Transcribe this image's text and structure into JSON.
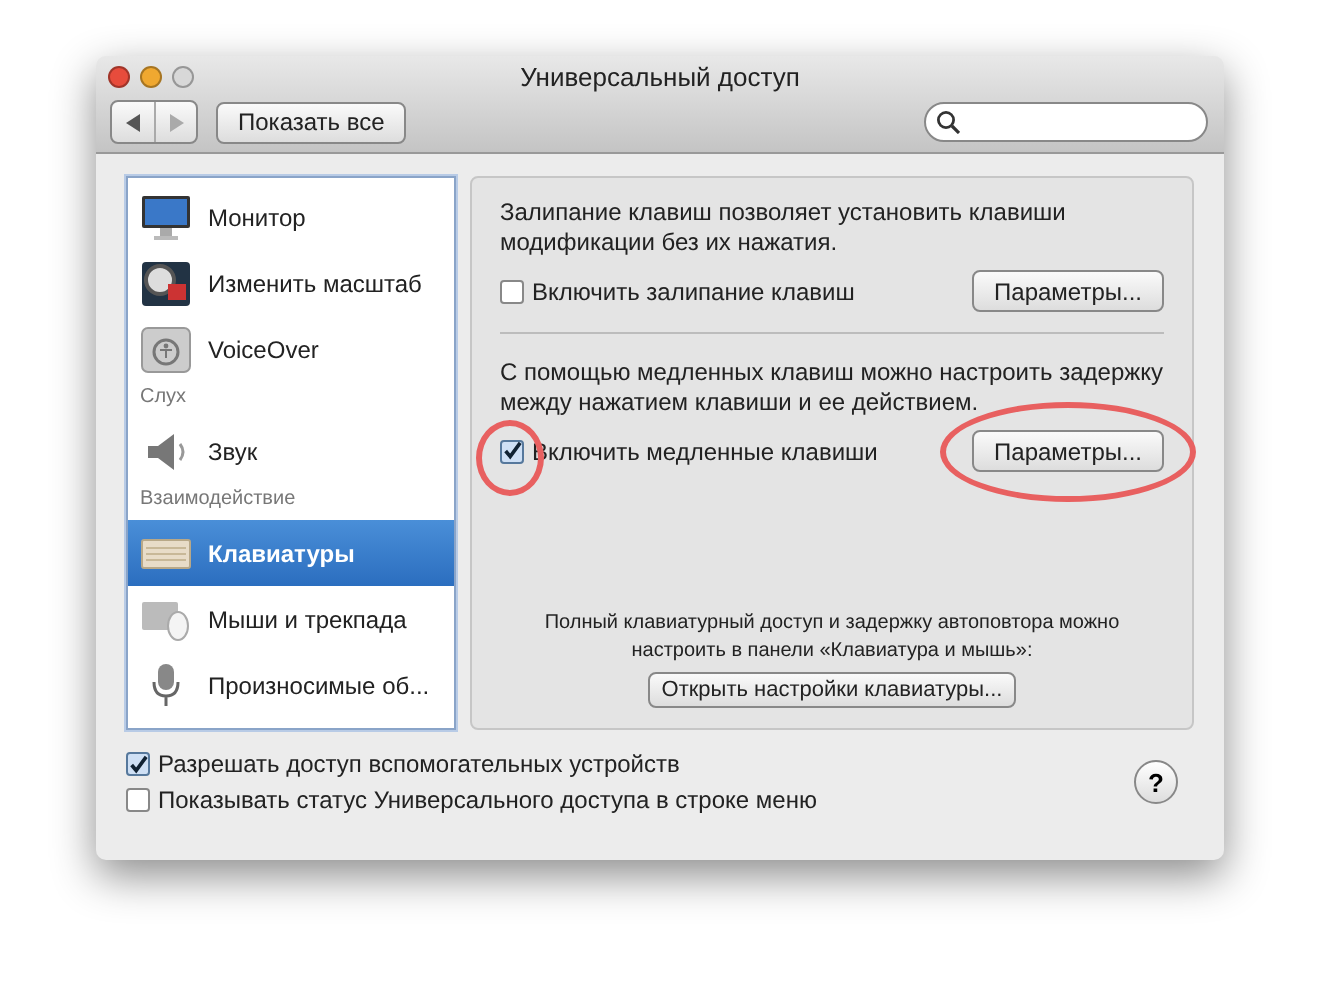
{
  "window": {
    "title": "Универсальный доступ"
  },
  "toolbar": {
    "show_all_button": "Показать все"
  },
  "sidebar": {
    "items": [
      {
        "kind": "item",
        "label": "Монитор",
        "selected": false
      },
      {
        "kind": "item",
        "label": "Изменить масштаб",
        "selected": false
      },
      {
        "kind": "item",
        "label": "VoiceOver",
        "selected": false
      },
      {
        "kind": "header",
        "label": "Слух"
      },
      {
        "kind": "item",
        "label": "Звук",
        "selected": false
      },
      {
        "kind": "header",
        "label": "Взаимодействие"
      },
      {
        "kind": "item",
        "label": "Клавиатуры",
        "selected": true
      },
      {
        "kind": "item",
        "label": "Мыши и трекпада",
        "selected": false
      },
      {
        "kind": "item",
        "label": "Произносимые об...",
        "selected": false
      }
    ]
  },
  "panel": {
    "sections": [
      {
        "description": "Залипание клавиш позволяет установить клавиши модификации без их нажатия.",
        "checkbox": {
          "label": "Включить залипание клавиш",
          "checked": false,
          "highlighted": false
        },
        "button": {
          "label": "Параметры...",
          "highlighted": false
        }
      },
      {
        "description": "С помощью медленных клавиш можно настроить задержку между нажатием клавиши и ее действием.",
        "checkbox": {
          "label": "Включить медленные клавиши",
          "checked": true,
          "highlighted": true
        },
        "button": {
          "label": "Параметры...",
          "highlighted": true
        }
      }
    ],
    "note": "Полный клавиатурный доступ и задержку автоповтора можно настроить в панели «Клавиатура и мышь»:",
    "open_keyboard_button": "Открыть настройки клавиатуры..."
  },
  "options": [
    {
      "label": "Разрешать доступ вспомогательных устройств",
      "checked": true
    },
    {
      "label": "Показывать статус Универсального доступа в строке меню",
      "checked": false
    }
  ],
  "help_button": "?"
}
